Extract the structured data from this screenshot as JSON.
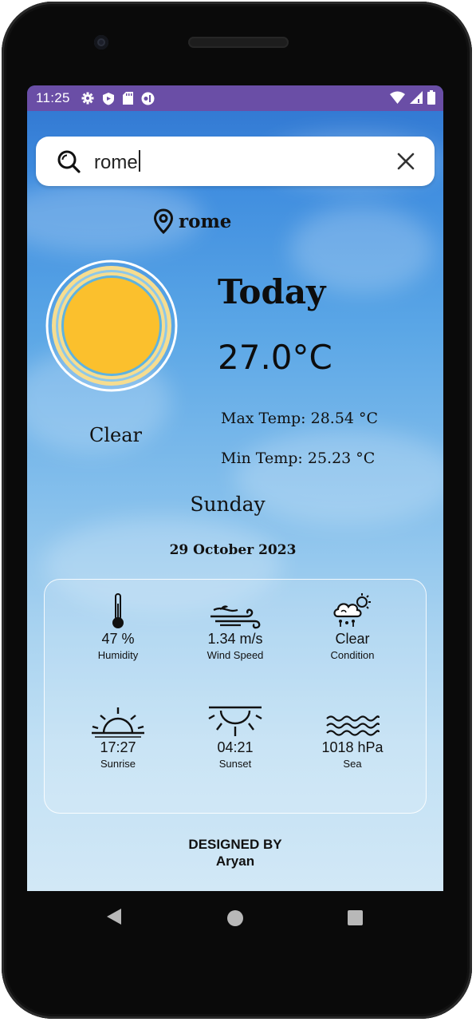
{
  "status_bar": {
    "time": "11:25",
    "left_icons": [
      "gear-icon",
      "shield-icon",
      "sd-card-icon",
      "app-icon"
    ],
    "right_icons": [
      "wifi-icon",
      "signal-icon",
      "battery-icon"
    ],
    "bar_color": "#6a4ea6"
  },
  "search": {
    "value": "rome",
    "icon": "search-icon",
    "clear_icon": "close-icon"
  },
  "location": {
    "city": "rome",
    "icon": "map-pin-icon"
  },
  "weather": {
    "heading": "Today",
    "temperature": "27.0°C",
    "max_temp": "Max Temp: 28.54 °C",
    "min_temp": "Min Temp: 25.23 °C",
    "condition": "Clear",
    "day": "Sunday",
    "date": "29 October 2023",
    "sun_color": "#fbc02d"
  },
  "details": [
    {
      "icon": "thermometer-icon",
      "value": "47 %",
      "label": "Humidity"
    },
    {
      "icon": "wind-icon",
      "value": "1.34 m/s",
      "label": "Wind Speed"
    },
    {
      "icon": "cloud-sun-rain-icon",
      "value": "Clear",
      "label": "Condition"
    },
    {
      "icon": "sunrise-icon",
      "value": "17:27",
      "label": "Sunrise"
    },
    {
      "icon": "sunset-icon",
      "value": "04:21",
      "label": "Sunset"
    },
    {
      "icon": "waves-icon",
      "value": "1018 hPa",
      "label": "Sea"
    }
  ],
  "footer": {
    "line1": "DESIGNED BY",
    "line2": "Aryan"
  },
  "nav": {
    "icons": [
      "back-icon",
      "home-icon",
      "recents-icon"
    ]
  }
}
